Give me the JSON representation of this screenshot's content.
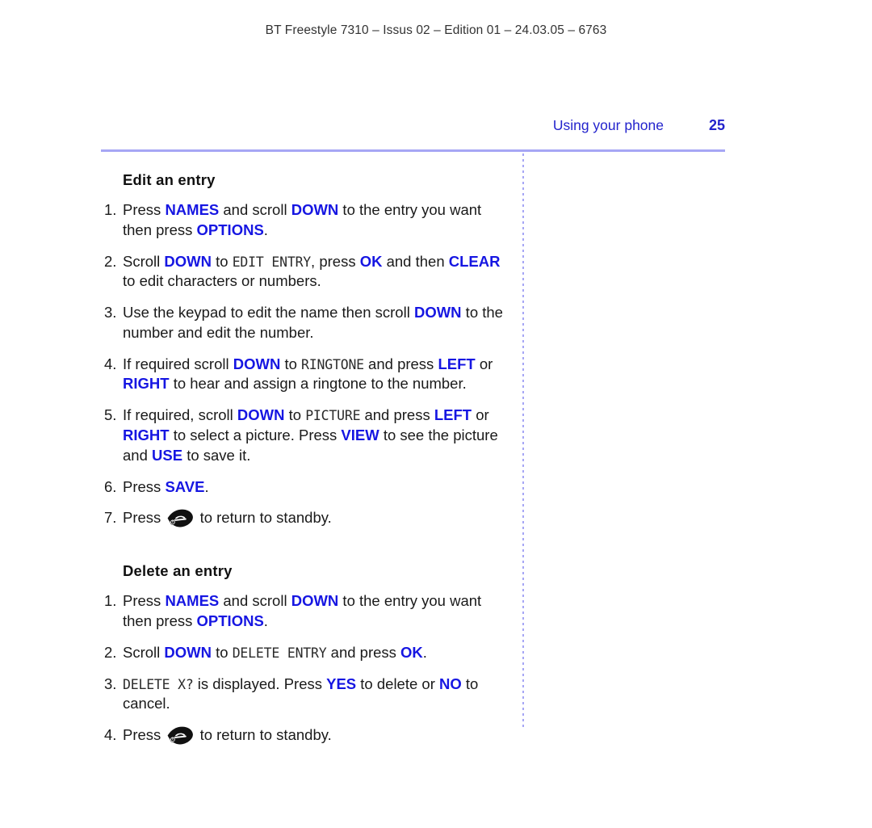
{
  "header": {
    "running_head": "BT Freestyle 7310 – Issus 02 – Edition 01 – 24.03.05 – 6763"
  },
  "page_head": {
    "section_title": "Using your phone",
    "page_number": "25"
  },
  "colors": {
    "keyword_blue": "#1616e2",
    "header_blue": "#2323cc",
    "rule_lavender": "#a6a6f5",
    "body_text": "#1a1a1a"
  },
  "icons": {
    "standby": "hangup-phone-icon"
  },
  "sections": [
    {
      "heading": "Edit an entry",
      "steps": [
        {
          "num": "1.",
          "parts": [
            {
              "t": "plain",
              "v": "Press "
            },
            {
              "t": "key",
              "v": "NAMES"
            },
            {
              "t": "plain",
              "v": " and scroll "
            },
            {
              "t": "key",
              "v": "DOWN"
            },
            {
              "t": "plain",
              "v": " to the entry you want then press "
            },
            {
              "t": "key",
              "v": "OPTIONS"
            },
            {
              "t": "plain",
              "v": "."
            }
          ]
        },
        {
          "num": "2.",
          "parts": [
            {
              "t": "plain",
              "v": "Scroll "
            },
            {
              "t": "key",
              "v": "DOWN"
            },
            {
              "t": "plain",
              "v": " to "
            },
            {
              "t": "lcd",
              "v": "EDIT ENTRY"
            },
            {
              "t": "plain",
              "v": ", press "
            },
            {
              "t": "key",
              "v": "OK"
            },
            {
              "t": "plain",
              "v": " and then "
            },
            {
              "t": "key",
              "v": "CLEAR"
            },
            {
              "t": "plain",
              "v": " to edit characters or numbers."
            }
          ]
        },
        {
          "num": "3.",
          "parts": [
            {
              "t": "plain",
              "v": "Use the keypad to edit the name then scroll "
            },
            {
              "t": "key",
              "v": "DOWN"
            },
            {
              "t": "plain",
              "v": " to the number and edit the number."
            }
          ]
        },
        {
          "num": "4.",
          "parts": [
            {
              "t": "plain",
              "v": "If required scroll "
            },
            {
              "t": "key",
              "v": "DOWN"
            },
            {
              "t": "plain",
              "v": " to "
            },
            {
              "t": "lcd",
              "v": "RINGTONE"
            },
            {
              "t": "plain",
              "v": " and press "
            },
            {
              "t": "key",
              "v": "LEFT"
            },
            {
              "t": "plain",
              "v": " or "
            },
            {
              "t": "key",
              "v": "RIGHT"
            },
            {
              "t": "plain",
              "v": " to hear and assign a ringtone to the number."
            }
          ]
        },
        {
          "num": "5.",
          "parts": [
            {
              "t": "plain",
              "v": "If required, scroll "
            },
            {
              "t": "key",
              "v": "DOWN"
            },
            {
              "t": "plain",
              "v": " to "
            },
            {
              "t": "lcd",
              "v": "PICTURE"
            },
            {
              "t": "plain",
              "v": " and press "
            },
            {
              "t": "key",
              "v": "LEFT"
            },
            {
              "t": "plain",
              "v": " or "
            },
            {
              "t": "key",
              "v": "RIGHT"
            },
            {
              "t": "plain",
              "v": " to select a picture. Press "
            },
            {
              "t": "key",
              "v": "VIEW"
            },
            {
              "t": "plain",
              "v": " to see the picture and "
            },
            {
              "t": "key",
              "v": "USE"
            },
            {
              "t": "plain",
              "v": " to save it."
            }
          ]
        },
        {
          "num": "6.",
          "parts": [
            {
              "t": "plain",
              "v": "Press "
            },
            {
              "t": "key",
              "v": "SAVE"
            },
            {
              "t": "plain",
              "v": "."
            }
          ]
        },
        {
          "num": "7.",
          "parts": [
            {
              "t": "plain",
              "v": "Press "
            },
            {
              "t": "icon",
              "v": "standby"
            },
            {
              "t": "plain",
              "v": " to return to standby."
            }
          ]
        }
      ]
    },
    {
      "heading": "Delete an entry",
      "steps": [
        {
          "num": "1.",
          "parts": [
            {
              "t": "plain",
              "v": "Press "
            },
            {
              "t": "key",
              "v": "NAMES"
            },
            {
              "t": "plain",
              "v": " and scroll "
            },
            {
              "t": "key",
              "v": "DOWN"
            },
            {
              "t": "plain",
              "v": " to the entry you want then press "
            },
            {
              "t": "key",
              "v": "OPTIONS"
            },
            {
              "t": "plain",
              "v": "."
            }
          ]
        },
        {
          "num": "2.",
          "parts": [
            {
              "t": "plain",
              "v": "Scroll "
            },
            {
              "t": "key",
              "v": "DOWN"
            },
            {
              "t": "plain",
              "v": " to "
            },
            {
              "t": "lcd",
              "v": "DELETE ENTRY"
            },
            {
              "t": "plain",
              "v": " and press "
            },
            {
              "t": "key",
              "v": "OK"
            },
            {
              "t": "plain",
              "v": "."
            }
          ]
        },
        {
          "num": "3.",
          "parts": [
            {
              "t": "lcd",
              "v": "DELETE X?"
            },
            {
              "t": "plain",
              "v": " is displayed. Press "
            },
            {
              "t": "key",
              "v": "YES"
            },
            {
              "t": "plain",
              "v": " to delete or "
            },
            {
              "t": "key",
              "v": "NO"
            },
            {
              "t": "plain",
              "v": " to cancel."
            }
          ]
        },
        {
          "num": "4.",
          "parts": [
            {
              "t": "plain",
              "v": "Press "
            },
            {
              "t": "icon",
              "v": "standby"
            },
            {
              "t": "plain",
              "v": " to return to standby."
            }
          ]
        }
      ]
    }
  ]
}
